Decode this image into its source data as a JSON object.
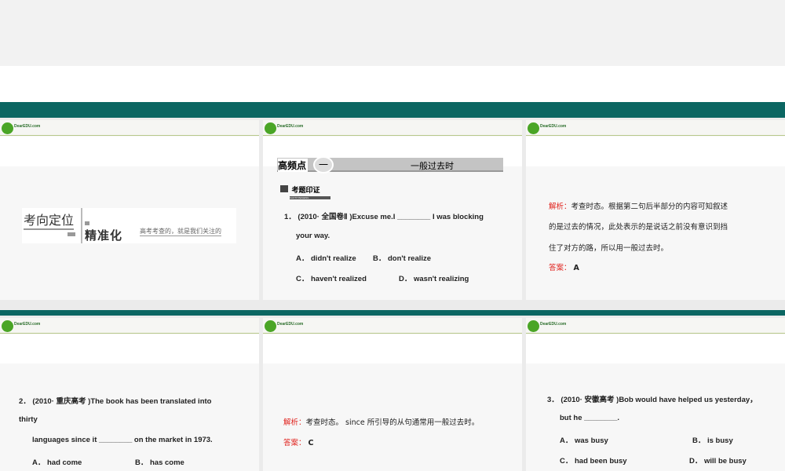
{
  "brand": {
    "logo_text": "DearEDU.com",
    "colors": {
      "band": "#0b6662",
      "red": "#e0201b",
      "accent_line": "#b7c88a"
    }
  },
  "slides": [
    {
      "title_main": "考向定位",
      "title_sub": "精准化",
      "tagline": "高考考查的，就是我们关注的"
    },
    {
      "banner_label": "高频点",
      "banner_num": "一",
      "banner_topic": "一般过去时",
      "section_tag": "考题印证",
      "section_tag_en": "KAOTIYINZHENG",
      "question": "1． (2010· 全国卷Ⅱ )Excuse me.I ________ I was blocking",
      "question_cont": "your way.",
      "options": [
        "A． didn't realize",
        "B． don't realize",
        "C． haven't realized",
        "D． wasn't realizing"
      ]
    },
    {
      "analysis_label": "解析：",
      "analysis_lines": [
        "考查时态。根据第二句后半部分的内容可知叙述",
        "的是过去的情况，此处表示的是说话之前没有意识到挡",
        "住了对方的路，所以用一般过去时。"
      ],
      "answer_label": "答案：",
      "answer": "A"
    },
    {
      "question": "2． (2010· 重庆高考 )The book has been translated into",
      "question_cont": "thirty",
      "question_cont2": "languages since it ________ on the market in 1973.",
      "options": [
        "A． had come",
        "B． has come"
      ]
    },
    {
      "analysis_label": "解析：",
      "analysis": "考查时态。 since 所引导的从句通常用一般过去时。",
      "answer_label": "答案：",
      "answer": "C"
    },
    {
      "question": "3． (2010· 安徽高考 )Bob would have helped us yesterday，",
      "question_cont": "but he ________.",
      "options": [
        "A． was busy",
        "B． is busy",
        "C． had been busy",
        "D． will be busy"
      ]
    }
  ]
}
